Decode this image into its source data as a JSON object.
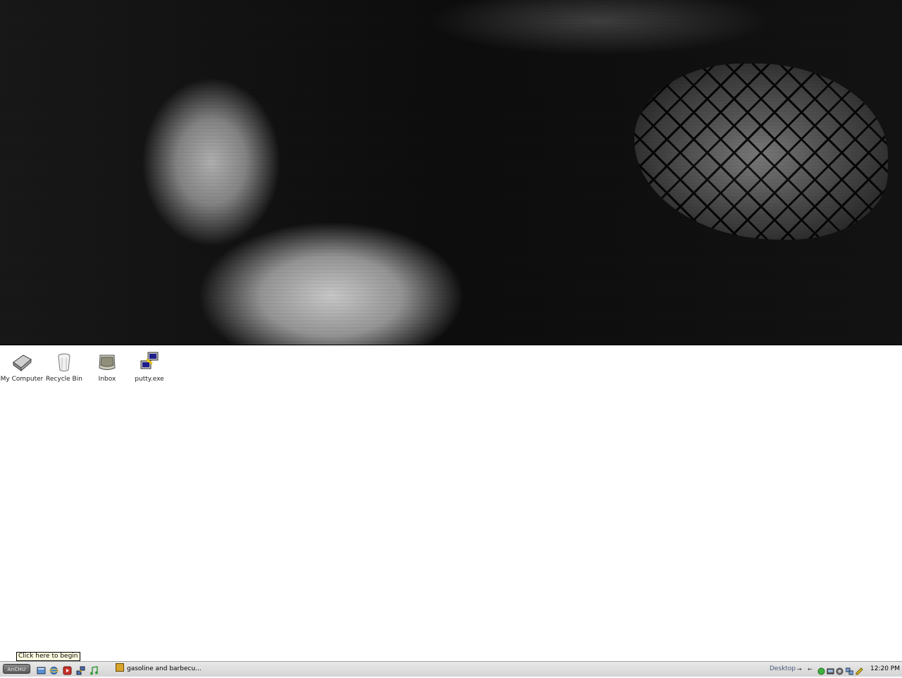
{
  "desktop": {
    "icons": [
      {
        "label": "My Computer"
      },
      {
        "label": "Recycle Bin"
      },
      {
        "label": "Inbox"
      },
      {
        "label": "putty.exe"
      }
    ]
  },
  "tooltip": {
    "text": "Click here to begin"
  },
  "taskbar": {
    "start_label": "AnCHU",
    "quick_launch": [
      "desktop-icon",
      "internet-explorer-icon",
      "media-icon",
      "network-icon",
      "music-icon"
    ],
    "window_button_label": "gasoline and barbecu...",
    "toolbar_label": "Desktop",
    "tray_icons": [
      "green-status-icon",
      "network-tray-icon",
      "headphones-tray-icon",
      "network-computers-tray-icon",
      "pencil-tray-icon"
    ],
    "clock": "12:20 PM"
  },
  "colors": {
    "taskbar": "#d4d4d4",
    "tooltip_bg": "#ffffe1",
    "desktop_bg": "#ffffff"
  }
}
